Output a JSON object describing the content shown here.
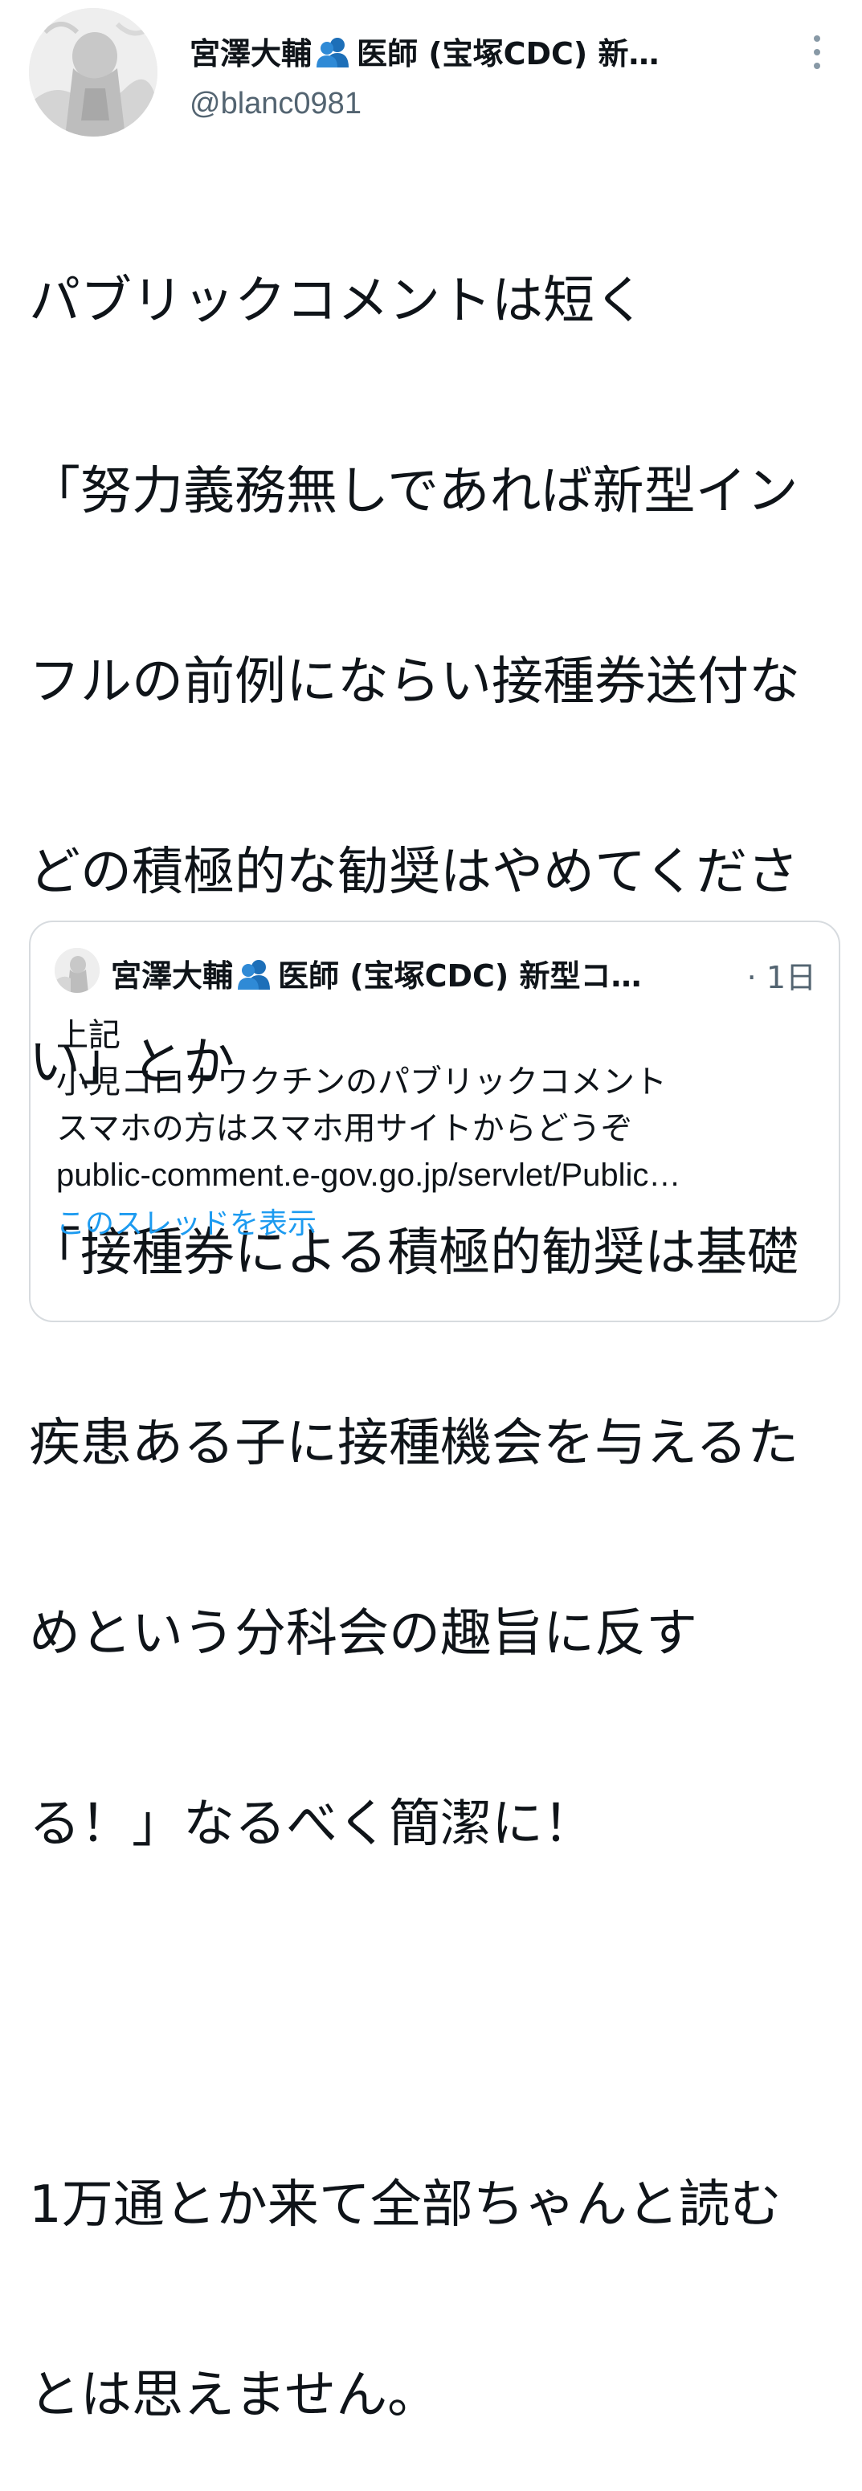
{
  "author": {
    "name_part1": "宮澤大輔",
    "badge_icon": "people-icon",
    "name_part2": "医師 (宝塚CDC) 新…",
    "handle": "@blanc0981"
  },
  "tweet": {
    "lines": [
      "パブリックコメントは短く",
      "「努力義務無しであれば新型イン",
      "フルの前例にならい接種券送付な",
      "どの積極的な勧奨はやめてくださ",
      "い」とか",
      "「接種券による積極的勧奨は基礎",
      "疾患ある子に接種機会を与えるた",
      "めという分科会の趣旨に反す",
      "る！」なるべく簡潔に！",
      "",
      "1万通とか来て全部ちゃんと読む",
      "とは思えません。"
    ]
  },
  "quote": {
    "name_part1": "宮澤大輔",
    "badge_icon": "people-icon",
    "name_part2": "医師 (宝塚CDC) 新型コ…",
    "time": "· 1日",
    "lines": [
      "上記",
      "小児コロナワクチンのパブリックコメント",
      "スマホの方はスマホ用サイトからどうぞ",
      "public-comment.e-gov.go.jp/servlet/Public…"
    ],
    "show_thread": "このスレッドを表示"
  },
  "colors": {
    "text": "#0f1419",
    "secondary": "#536471",
    "link": "#1d9bf0",
    "badge": "#1d6fb8",
    "border": "#d7dbdf"
  }
}
